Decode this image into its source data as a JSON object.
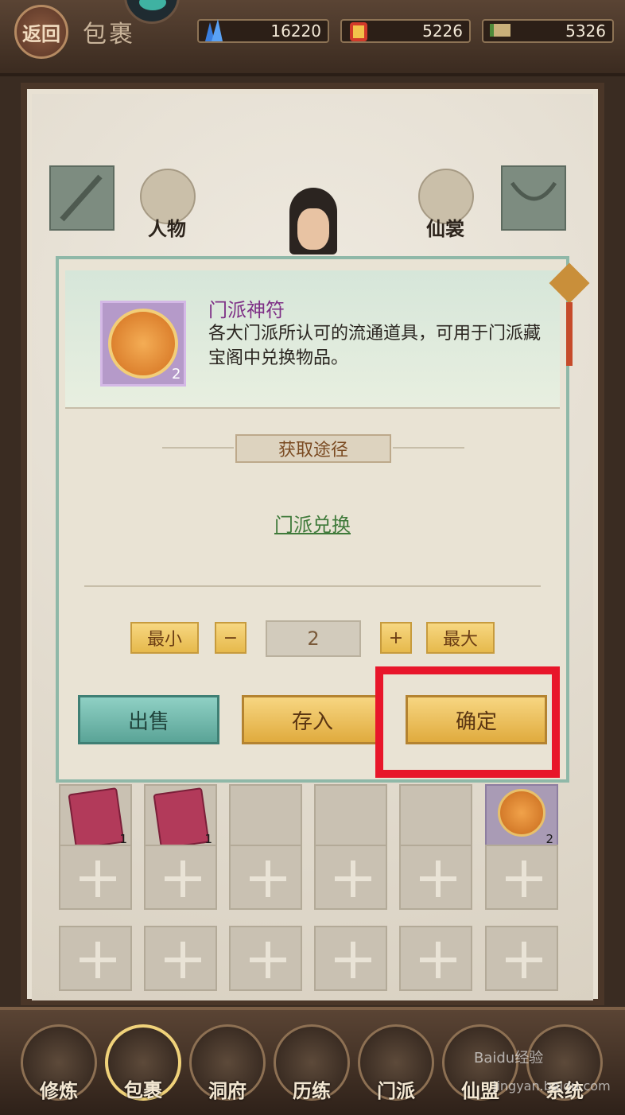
{
  "header": {
    "back_label": "返回",
    "title": "包裹",
    "currencies": [
      {
        "icon": "crystal-icon",
        "value": "16220"
      },
      {
        "icon": "gold-token-icon",
        "value": "5226"
      },
      {
        "icon": "scroll-ticket-icon",
        "value": "5326"
      }
    ]
  },
  "character": {
    "tab_person": "人物",
    "tab_costume": "仙裳"
  },
  "dialog": {
    "item_name": "门派神符",
    "item_count": "2",
    "item_desc": "各大门派所认可的流通道具，可用于门派藏宝阁中兑换物品。",
    "section_title": "获取途径",
    "source_link": "门派兑换",
    "min_label": "最小",
    "minus_label": "−",
    "quantity": "2",
    "plus_label": "+",
    "max_label": "最大",
    "sell_label": "出售",
    "deposit_label": "存入",
    "confirm_label": "确定"
  },
  "inventory": {
    "row1_counts": [
      "1",
      "1",
      "2"
    ]
  },
  "nav": {
    "items": [
      "修炼",
      "包裹",
      "洞府",
      "历练",
      "门派",
      "仙盟",
      "系统"
    ],
    "active": "包裹"
  },
  "watermark": {
    "text": "Baidu经验",
    "url": "jingyan.baidu.com"
  }
}
